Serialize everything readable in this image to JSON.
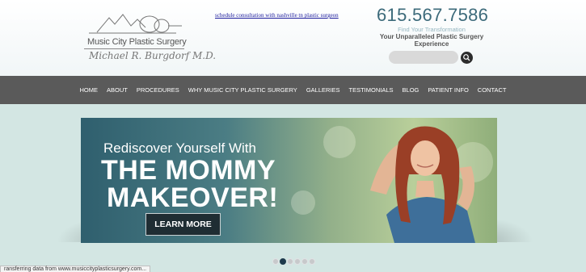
{
  "header": {
    "logo_title": "Music City Plastic Surgery",
    "logo_signature": "Michael R. Burgdorf M.D.",
    "consult_link": "schedule consultation with nashville tn plastic surgeon",
    "phone": "615.567.7586",
    "tagline_small": "Find Your Transformation",
    "tagline_main": "Your Unparalleled Plastic Surgery Experience",
    "search_placeholder": "",
    "search_icon": "search-icon"
  },
  "nav": {
    "items": [
      {
        "label": "HOME"
      },
      {
        "label": "ABOUT"
      },
      {
        "label": "PROCEDURES"
      },
      {
        "label": "WHY MUSIC CITY PLASTIC SURGERY"
      },
      {
        "label": "GALLERIES"
      },
      {
        "label": "TESTIMONIALS"
      },
      {
        "label": "BLOG"
      },
      {
        "label": "PATIENT INFO"
      },
      {
        "label": "CONTACT"
      }
    ]
  },
  "hero": {
    "line1": "Rediscover Yourself With",
    "line2": "THE MOMMY",
    "line3": "MAKEOVER!",
    "button": "LEARN MORE"
  },
  "slider": {
    "count": 6,
    "active_index": 1
  },
  "status_bar": "ransferring data from www.musiccityplasticsurgery.com...",
  "colors": {
    "nav_bg": "#5a5a5a",
    "phone": "#3c6a7a",
    "page_bg": "#d3e6e3",
    "button_bg": "#1f2d33"
  }
}
